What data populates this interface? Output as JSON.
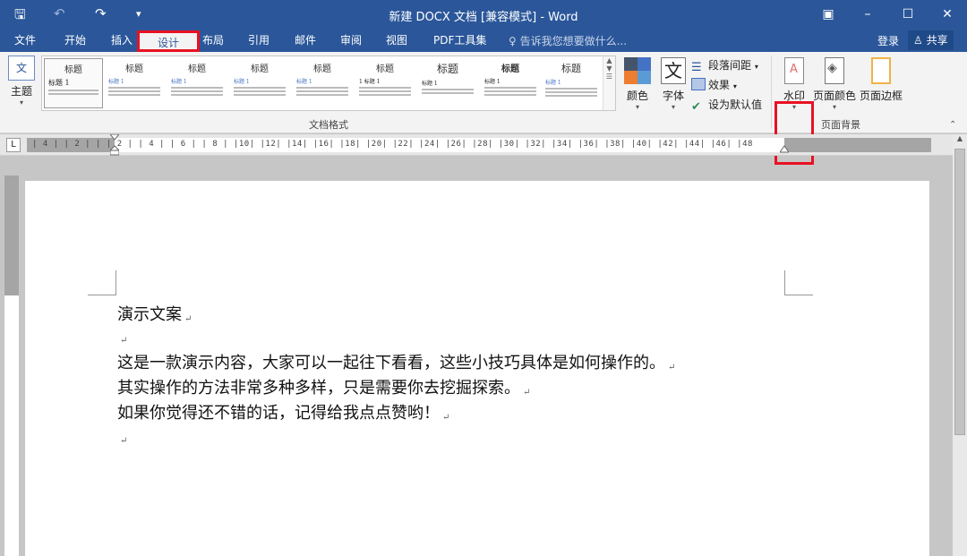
{
  "window": {
    "title": "新建 DOCX 文档 [兼容模式] - Word",
    "qa_icons": [
      "save-icon",
      "undo-icon",
      "redo-icon",
      "customize-icon"
    ],
    "qa_glyphs": [
      "🖫",
      "↶",
      "↷",
      "▾"
    ]
  },
  "tabs": [
    {
      "label": "文件"
    },
    {
      "label": "开始"
    },
    {
      "label": "插入"
    },
    {
      "label": "设计",
      "active": true
    },
    {
      "label": "布局"
    },
    {
      "label": "引用"
    },
    {
      "label": "邮件"
    },
    {
      "label": "审阅"
    },
    {
      "label": "视图"
    },
    {
      "label": "PDF工具集"
    }
  ],
  "tell_me": "告诉我您想要做什么...",
  "login": "登录",
  "share": "共享",
  "ribbon": {
    "theme_label": "主题",
    "gallery_group_label": "文档格式",
    "thumbs": [
      {
        "title": "标题",
        "sub": "标题 1"
      },
      {
        "title": "标题",
        "sub": "标题 1"
      },
      {
        "title": "标题",
        "sub": "标题 1"
      },
      {
        "title": "标题",
        "sub": "标题 1"
      },
      {
        "title": "标题",
        "sub": "标题 1"
      },
      {
        "title": "标题",
        "sub": "1 标题 1"
      },
      {
        "title": "标题",
        "sub": "标题 1"
      },
      {
        "title": "标题",
        "sub": "标题 1"
      },
      {
        "title": "标题",
        "sub": "标题 1"
      }
    ],
    "colors_label": "颜色",
    "fonts_label": "字体",
    "font_glyph": "文",
    "paragraph_spacing": "段落间距",
    "effects": "效果",
    "set_default": "设为默认值",
    "watermark": "水印",
    "page_color": "页面颜色",
    "page_border": "页面边框",
    "page_bg_group_label": "页面背景",
    "accent_red": "#e81123",
    "brand_blue": "#2b579a"
  },
  "ruler": {
    "marks": "| 4 |  | 2 |   |   | 2 |  | 4 |  | 6 |  | 8 |  |10|  |12|  |14|  |16|  |18|  |20|  |22|  |24|  |26|  |28|  |30|  |32|  |34|  |36|  |38|  |40|  |42|  |44|  |46|  |48"
  },
  "document": {
    "lines": [
      "演示文案",
      "",
      "这是一款演示内容，大家可以一起往下看看，这些小技巧具体是如何操作的。",
      "其实操作的方法非常多种多样，只是需要你去挖掘探索。",
      "如果你觉得还不错的话，记得给我点点赞哟！",
      ""
    ],
    "para_mark": "↵"
  }
}
